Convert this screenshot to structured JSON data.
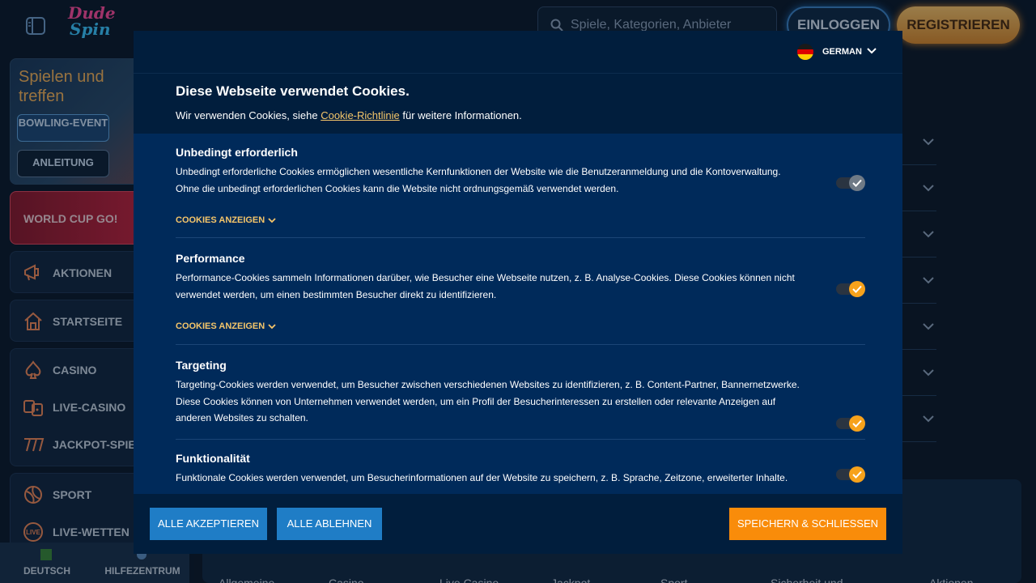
{
  "header": {
    "logo_line1": "Dude",
    "logo_line2": "Spin",
    "search_placeholder": "Spiele, Kategorien, Anbieter",
    "login_label": "EINLOGGEN",
    "register_label": "REGISTRIEREN"
  },
  "sidebar": {
    "promo": {
      "title": "Spielen und treffen",
      "event_button": "BOWLING-EVENT",
      "guide_button": "ANLEITUNG"
    },
    "world_cup_label": "WORLD CUP GO!",
    "items": [
      {
        "label": "AKTIONEN",
        "icon": "megaphone-icon"
      },
      {
        "label": "STARTSEITE",
        "icon": "home-icon"
      },
      {
        "label": "CASINO",
        "icon": "spade-icon"
      },
      {
        "label": "LIVE-CASINO",
        "icon": "dice-icon"
      },
      {
        "label": "JACKPOT-SPIELE",
        "icon": "sevens-icon"
      },
      {
        "label": "SPORT",
        "icon": "volleyball-icon"
      },
      {
        "label": "LIVE-WETTEN",
        "icon": "live-icon"
      }
    ],
    "footer": {
      "language_label": "DEUTSCH",
      "help_label": "HILFEZENTRUM"
    }
  },
  "footer_links": [
    "Allgemeine",
    "Casino",
    "Live Casino",
    "Jackpot",
    "Sport",
    "Sicherheit und",
    "Aktionen"
  ],
  "cookie_modal": {
    "language": "GERMAN",
    "title": "Diese Webseite verwendet Cookies.",
    "intro_before": "Wir verwenden Cookies, siehe ",
    "intro_link": "Cookie-Richtlinie",
    "intro_after": " für weitere Informationen.",
    "show_cookies_label": "COOKIES ANZEIGEN",
    "categories": [
      {
        "title": "Unbedingt erforderlich",
        "description": "Unbedingt erforderliche Cookies ermöglichen wesentliche Kernfunktionen der Website wie die Benutzeranmeldung und die Kontoverwaltung. Ohne die unbedingt erforderlichen Cookies kann die Website nicht ordnungsgemäß verwendet werden.",
        "enabled": true,
        "locked": true
      },
      {
        "title": "Performance",
        "description": "Performance-Cookies sammeln Informationen darüber, wie Besucher eine Webseite nutzen, z. B. Analyse-Cookies. Diese Cookies können nicht verwendet werden, um einen bestimmten Besucher direkt zu identifizieren.",
        "enabled": true,
        "locked": false
      },
      {
        "title": "Targeting",
        "description": "Targeting-Cookies werden verwendet, um Besucher zwischen verschiedenen Websites zu identifizieren, z. B. Content-Partner, Bannernetzwerke. Diese Cookies können von Unternehmen verwendet werden, um ein Profil der Besucherinteressen zu erstellen oder relevante Anzeigen auf anderen Websites zu schalten.",
        "enabled": true,
        "locked": false
      },
      {
        "title": "Funktionalität",
        "description": "Funktionale Cookies werden verwendet, um Besucherinformationen auf der Website zu speichern, z. B. Sprache, Zeitzone, erweiterter Inhalte.",
        "enabled": true,
        "locked": false
      }
    ],
    "accept_all": "ALLE AKZEPTIEREN",
    "reject_all": "ALLE ABLEHNEN",
    "save_close": "SPEICHERN & SCHLIESSEN"
  },
  "colors": {
    "modal_bg": "#011e3d",
    "category_bg": "#002a5a",
    "link_accent": "#f6c66a",
    "toggle_on": "#f7a21b",
    "primary_button": "#1f7dc6",
    "save_button": "#f98c0a"
  }
}
